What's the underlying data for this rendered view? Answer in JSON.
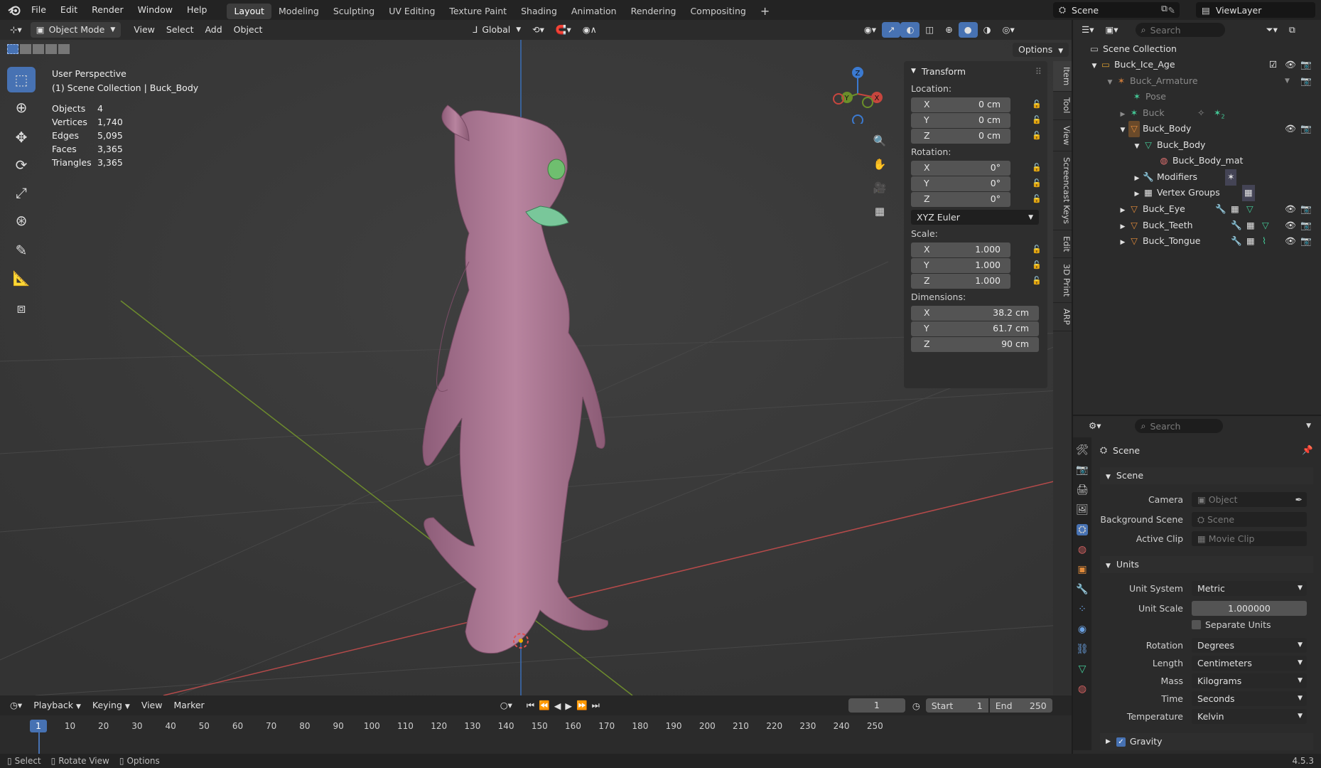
{
  "topbar": {
    "menus": [
      "File",
      "Edit",
      "Render",
      "Window",
      "Help"
    ],
    "workspaces": [
      "Layout",
      "Modeling",
      "Sculpting",
      "UV Editing",
      "Texture Paint",
      "Shading",
      "Animation",
      "Rendering",
      "Compositing"
    ],
    "add_tab": "+",
    "scene_name": "Scene",
    "view_layer": "ViewLayer"
  },
  "viewport_header": {
    "mode": "Object Mode",
    "menus": [
      "View",
      "Select",
      "Add",
      "Object"
    ],
    "orientation": "Global",
    "options": "Options"
  },
  "overlay": {
    "view_name": "User Perspective",
    "collection": "(1) Scene Collection | Buck_Body",
    "stats": [
      {
        "label": "Objects",
        "value": "4"
      },
      {
        "label": "Vertices",
        "value": "1,740"
      },
      {
        "label": "Edges",
        "value": "5,095"
      },
      {
        "label": "Faces",
        "value": "3,365"
      },
      {
        "label": "Triangles",
        "value": "3,365"
      }
    ]
  },
  "gizmo": {
    "x": "X",
    "y": "Y",
    "z": "Z"
  },
  "npanel": {
    "title": "Transform",
    "location_label": "Location:",
    "location": [
      {
        "k": "X",
        "v": "0 cm"
      },
      {
        "k": "Y",
        "v": "0 cm"
      },
      {
        "k": "Z",
        "v": "0 cm"
      }
    ],
    "rotation_label": "Rotation:",
    "rotation": [
      {
        "k": "X",
        "v": "0°"
      },
      {
        "k": "Y",
        "v": "0°"
      },
      {
        "k": "Z",
        "v": "0°"
      }
    ],
    "rotation_mode": "XYZ Euler",
    "scale_label": "Scale:",
    "scale": [
      {
        "k": "X",
        "v": "1.000"
      },
      {
        "k": "Y",
        "v": "1.000"
      },
      {
        "k": "Z",
        "v": "1.000"
      }
    ],
    "dimensions_label": "Dimensions:",
    "dimensions": [
      {
        "k": "X",
        "v": "38.2 cm"
      },
      {
        "k": "Y",
        "v": "61.7 cm"
      },
      {
        "k": "Z",
        "v": "90 cm"
      }
    ],
    "tabs": [
      "Item",
      "Tool",
      "View",
      "Screencast Keys",
      "Edit",
      "3D Print",
      "ARP"
    ]
  },
  "timeline": {
    "menus": [
      "Playback",
      "Keying",
      "View",
      "Marker"
    ],
    "current_frame": "1",
    "start_label": "Start",
    "start": "1",
    "end_label": "End",
    "end": "250",
    "ticks": [
      "10",
      "20",
      "30",
      "40",
      "50",
      "60",
      "70",
      "80",
      "90",
      "100",
      "110",
      "120",
      "130",
      "140",
      "150",
      "160",
      "170",
      "180",
      "190",
      "200",
      "210",
      "220",
      "230",
      "240",
      "250"
    ],
    "playhead": "1"
  },
  "outliner": {
    "search_placeholder": "Search",
    "rows": [
      {
        "label": "Scene Collection"
      },
      {
        "label": "Buck_Ice_Age"
      },
      {
        "label": "Buck_Armature"
      },
      {
        "label": "Pose"
      },
      {
        "label": "Buck"
      },
      {
        "label": "Buck_Body"
      },
      {
        "label": "Buck_Body"
      },
      {
        "label": "Buck_Body_mat"
      },
      {
        "label": "Modifiers"
      },
      {
        "label": "Vertex Groups"
      },
      {
        "label": "Buck_Eye"
      },
      {
        "label": "Buck_Teeth"
      },
      {
        "label": "Buck_Tongue"
      }
    ],
    "buck_badge": "2"
  },
  "properties": {
    "search_placeholder": "Search",
    "context": "Scene",
    "scene_section": "Scene",
    "camera_label": "Camera",
    "camera_placeholder": "Object",
    "bg_scene_label": "Background Scene",
    "bg_scene_placeholder": "Scene",
    "active_clip_label": "Active Clip",
    "active_clip_placeholder": "Movie Clip",
    "units_section": "Units",
    "unit_system_label": "Unit System",
    "unit_system": "Metric",
    "unit_scale_label": "Unit Scale",
    "unit_scale": "1.000000",
    "separate_units": "Separate Units",
    "rotation_label": "Rotation",
    "rotation": "Degrees",
    "length_label": "Length",
    "length": "Centimeters",
    "mass_label": "Mass",
    "mass": "Kilograms",
    "time_label": "Time",
    "time": "Seconds",
    "temperature_label": "Temperature",
    "temperature": "Kelvin",
    "gravity": "Gravity"
  },
  "statusbar": {
    "items": [
      "Select",
      "Rotate View",
      "Options"
    ],
    "version": "4.5.3"
  },
  "colors": {
    "accent": "#4772b3",
    "x_axis": "#c7463e",
    "y_axis": "#6b8f2a",
    "z_axis": "#3b7ad1",
    "body": "#b07a9a"
  }
}
